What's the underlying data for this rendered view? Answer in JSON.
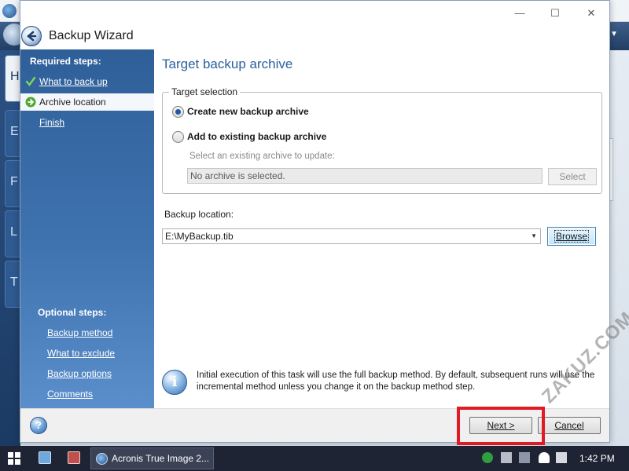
{
  "dialog": {
    "title": "Backup Wizard",
    "window_controls": {
      "minimize": "—",
      "maximize": "☐",
      "close": "✕"
    }
  },
  "steps": {
    "required_heading": "Required steps:",
    "required": [
      {
        "label": "What to back up",
        "state": "done"
      },
      {
        "label": "Archive location",
        "state": "current"
      },
      {
        "label": "Finish",
        "state": "pending"
      }
    ],
    "optional_heading": "Optional steps:",
    "optional": [
      "Backup method",
      "What to exclude",
      "Backup options",
      "Comments"
    ]
  },
  "content": {
    "title": "Target backup archive",
    "target_selection": {
      "legend": "Target selection",
      "option_new": "Create new backup archive",
      "option_existing": "Add to existing backup archive",
      "selected": "new",
      "hint": "Select an existing archive to update:",
      "archive_field_value": "No archive is selected.",
      "select_button": "Select"
    },
    "backup_location": {
      "label": "Backup location:",
      "value": "E:\\MyBackup.tib",
      "browse_button": "Browse"
    },
    "info": "Initial execution of this task will use the full backup method. By default, subsequent runs will use the incremental method unless you change it on the backup method step."
  },
  "footer": {
    "help": "?",
    "next_button": "Next >",
    "cancel_button": "Cancel"
  },
  "taskbar": {
    "task_label": "Acronis True Image 2...",
    "clock": "1:42 PM"
  },
  "background": {
    "side_tabs": [
      "H",
      "E",
      "F",
      "L",
      "T"
    ]
  },
  "watermark": "ZAKUZ.COM",
  "colors": {
    "accent": "#2a5f9e",
    "highlight": "#e01b24",
    "steps_panel": "#3f73b0"
  }
}
